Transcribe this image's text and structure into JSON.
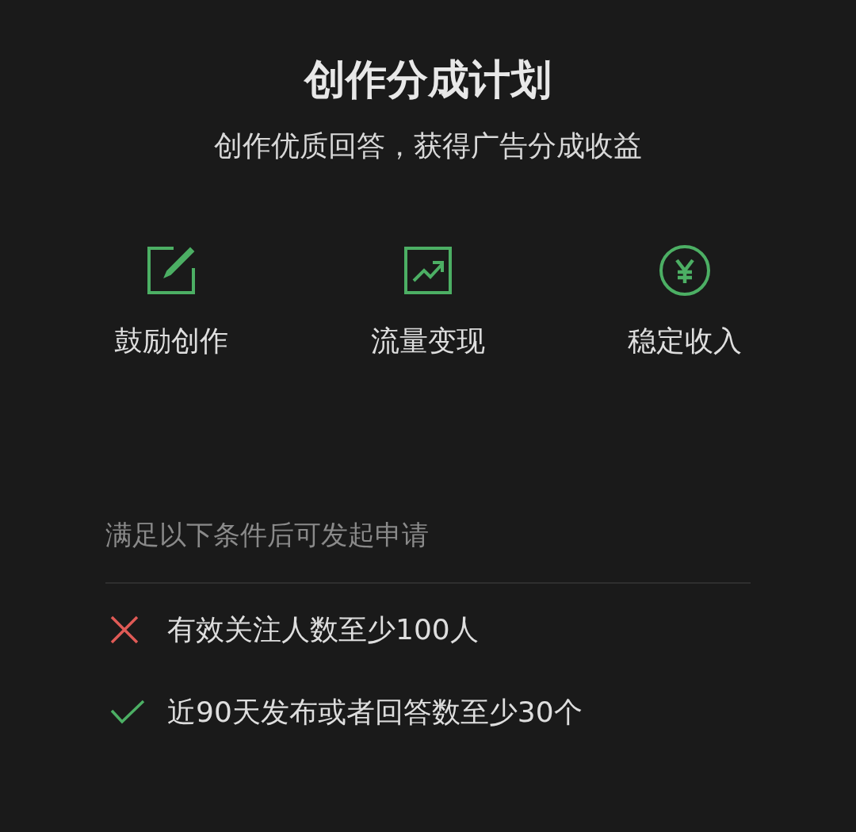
{
  "title": "创作分成计划",
  "subtitle": "创作优质回答，获得广告分成收益",
  "features": [
    {
      "kind": "edit",
      "label": "鼓励创作"
    },
    {
      "kind": "chart",
      "label": "流量变现"
    },
    {
      "kind": "yen",
      "label": "稳定收入"
    }
  ],
  "requirements": {
    "heading": "满足以下条件后可发起申请",
    "items": [
      {
        "text": "有效关注人数至少100人",
        "met": false
      },
      {
        "text": "近90天发布或者回答数至少30个",
        "met": true
      }
    ]
  }
}
